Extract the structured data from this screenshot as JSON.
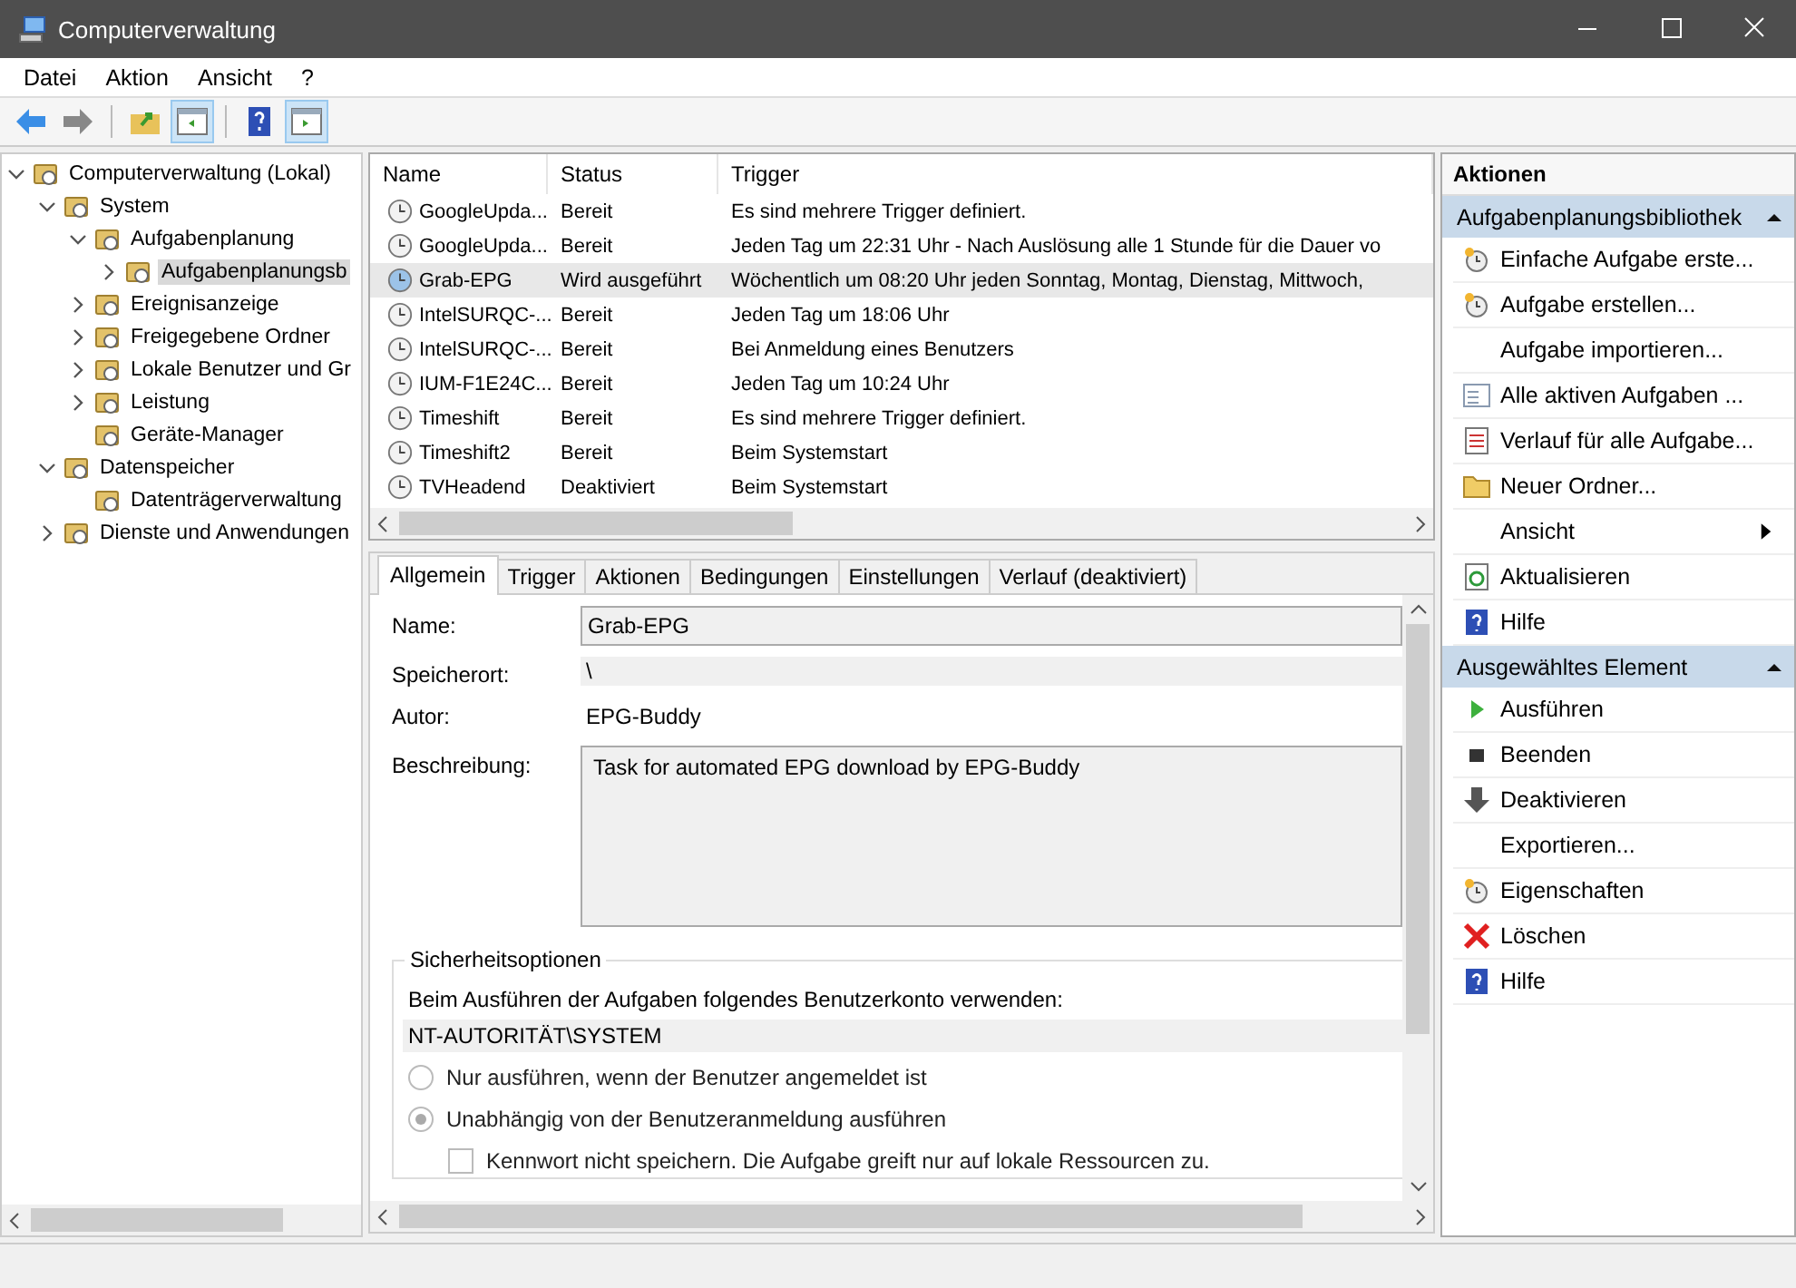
{
  "window": {
    "title": "Computerverwaltung"
  },
  "menu": [
    "Datei",
    "Aktion",
    "Ansicht",
    "?"
  ],
  "tree": [
    {
      "label": "Computerverwaltung (Lokal)",
      "expanded": true,
      "selected": false,
      "children": [
        {
          "label": "System",
          "expanded": true,
          "selected": false,
          "children": [
            {
              "label": "Aufgabenplanung",
              "expanded": true,
              "selected": false,
              "children": [
                {
                  "label": "Aufgabenplanungsb",
                  "expanded": false,
                  "selected": true
                }
              ]
            },
            {
              "label": "Ereignisanzeige",
              "expanded": false,
              "selected": false
            },
            {
              "label": "Freigegebene Ordner",
              "expanded": false,
              "selected": false
            },
            {
              "label": "Lokale Benutzer und Gr",
              "expanded": false,
              "selected": false
            },
            {
              "label": "Leistung",
              "expanded": false,
              "selected": false
            },
            {
              "label": "Geräte-Manager",
              "selected": false
            }
          ]
        },
        {
          "label": "Datenspeicher",
          "expanded": true,
          "selected": false,
          "children": [
            {
              "label": "Datenträgerverwaltung",
              "selected": false
            }
          ]
        },
        {
          "label": "Dienste und Anwendungen",
          "expanded": false,
          "selected": false
        }
      ]
    }
  ],
  "table": {
    "columns": [
      "Name",
      "Status",
      "Trigger"
    ],
    "rows": [
      {
        "name": "GoogleUpda...",
        "status": "Bereit",
        "trigger": "Es sind mehrere Trigger definiert.",
        "selected": false
      },
      {
        "name": "GoogleUpda...",
        "status": "Bereit",
        "trigger": "Jeden Tag um 22:31 Uhr - Nach Auslösung alle 1 Stunde für die Dauer vo",
        "selected": false
      },
      {
        "name": "Grab-EPG",
        "status": "Wird ausgeführt",
        "trigger": "Wöchentlich um 08:20 Uhr jeden Sonntag, Montag, Dienstag, Mittwoch,",
        "selected": true
      },
      {
        "name": "IntelSURQC-...",
        "status": "Bereit",
        "trigger": "Jeden Tag um 18:06 Uhr",
        "selected": false
      },
      {
        "name": "IntelSURQC-...",
        "status": "Bereit",
        "trigger": "Bei Anmeldung eines Benutzers",
        "selected": false
      },
      {
        "name": "IUM-F1E24C...",
        "status": "Bereit",
        "trigger": "Jeden Tag um 10:24 Uhr",
        "selected": false
      },
      {
        "name": "Timeshift",
        "status": "Bereit",
        "trigger": "Es sind mehrere Trigger definiert.",
        "selected": false
      },
      {
        "name": "Timeshift2",
        "status": "Bereit",
        "trigger": "Beim Systemstart",
        "selected": false
      },
      {
        "name": "TVHeadend",
        "status": "Deaktiviert",
        "trigger": "Beim Systemstart",
        "selected": false
      }
    ]
  },
  "tabs": [
    {
      "label": "Allgemein",
      "selected": true
    },
    {
      "label": "Trigger",
      "selected": false
    },
    {
      "label": "Aktionen",
      "selected": false
    },
    {
      "label": "Bedingungen",
      "selected": false
    },
    {
      "label": "Einstellungen",
      "selected": false
    },
    {
      "label": "Verlauf (deaktiviert)",
      "selected": false
    }
  ],
  "details": [
    {
      "label": "Name:",
      "value": "Grab-EPG",
      "kind": "input"
    },
    {
      "label": "Speicherort:",
      "value": "\\",
      "kind": "readonly"
    },
    {
      "label": "Autor:",
      "value": "EPG-Buddy",
      "kind": "text"
    },
    {
      "label": "Beschreibung:",
      "value": "Task for automated EPG download by EPG-Buddy",
      "kind": "textarea"
    }
  ],
  "security": {
    "title": "Sicherheitsoptionen",
    "account_label": "Beim Ausführen der Aufgaben folgendes Benutzerkonto verwenden:",
    "account": "NT-AUTORITÄT\\SYSTEM",
    "options": [
      {
        "kind": "radio",
        "label": "Nur ausführen, wenn der Benutzer angemeldet ist",
        "selected": false
      },
      {
        "kind": "radio",
        "label": "Unabhängig von der Benutzeranmeldung ausführen",
        "selected": true
      },
      {
        "kind": "checkbox",
        "label": "Kennwort nicht speichern. Die Aufgabe greift nur auf lokale Ressourcen zu.",
        "checked": false
      }
    ]
  },
  "actions": {
    "title": "Aktionen",
    "sections": [
      {
        "title": "Aufgabenplanungsbibliothek",
        "expanded": true,
        "items": [
          {
            "label": "Einfache Aufgabe erste...",
            "submenu": false
          },
          {
            "label": "Aufgabe erstellen...",
            "submenu": false
          },
          {
            "label": "Aufgabe importieren...",
            "submenu": false
          },
          {
            "label": "Alle aktiven Aufgaben ...",
            "submenu": false
          },
          {
            "label": "Verlauf für alle Aufgabe...",
            "submenu": false
          },
          {
            "label": "Neuer Ordner...",
            "submenu": false
          },
          {
            "label": "Ansicht",
            "submenu": true
          },
          {
            "label": "Aktualisieren",
            "submenu": false
          },
          {
            "label": "Hilfe",
            "submenu": false
          }
        ]
      },
      {
        "title": "Ausgewähltes Element",
        "expanded": true,
        "items": [
          {
            "label": "Ausführen",
            "submenu": false
          },
          {
            "label": "Beenden",
            "submenu": false
          },
          {
            "label": "Deaktivieren",
            "submenu": false
          },
          {
            "label": "Exportieren...",
            "submenu": false
          },
          {
            "label": "Eigenschaften",
            "submenu": false
          },
          {
            "label": "Löschen",
            "submenu": false
          },
          {
            "label": "Hilfe",
            "submenu": false
          }
        ]
      }
    ]
  }
}
